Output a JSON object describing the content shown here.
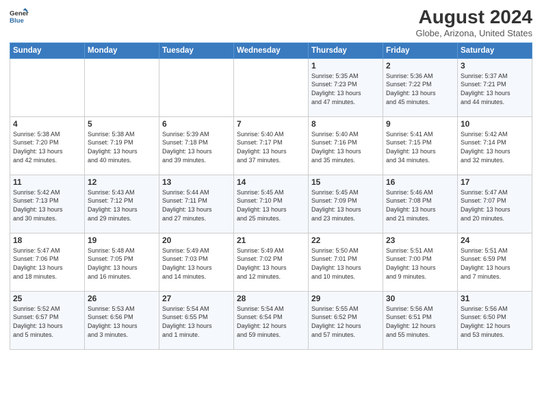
{
  "header": {
    "logo_line1": "General",
    "logo_line2": "Blue",
    "month_year": "August 2024",
    "location": "Globe, Arizona, United States"
  },
  "days_of_week": [
    "Sunday",
    "Monday",
    "Tuesday",
    "Wednesday",
    "Thursday",
    "Friday",
    "Saturday"
  ],
  "weeks": [
    [
      {
        "day": "",
        "content": ""
      },
      {
        "day": "",
        "content": ""
      },
      {
        "day": "",
        "content": ""
      },
      {
        "day": "",
        "content": ""
      },
      {
        "day": "1",
        "content": "Sunrise: 5:35 AM\nSunset: 7:23 PM\nDaylight: 13 hours\nand 47 minutes."
      },
      {
        "day": "2",
        "content": "Sunrise: 5:36 AM\nSunset: 7:22 PM\nDaylight: 13 hours\nand 45 minutes."
      },
      {
        "day": "3",
        "content": "Sunrise: 5:37 AM\nSunset: 7:21 PM\nDaylight: 13 hours\nand 44 minutes."
      }
    ],
    [
      {
        "day": "4",
        "content": "Sunrise: 5:38 AM\nSunset: 7:20 PM\nDaylight: 13 hours\nand 42 minutes."
      },
      {
        "day": "5",
        "content": "Sunrise: 5:38 AM\nSunset: 7:19 PM\nDaylight: 13 hours\nand 40 minutes."
      },
      {
        "day": "6",
        "content": "Sunrise: 5:39 AM\nSunset: 7:18 PM\nDaylight: 13 hours\nand 39 minutes."
      },
      {
        "day": "7",
        "content": "Sunrise: 5:40 AM\nSunset: 7:17 PM\nDaylight: 13 hours\nand 37 minutes."
      },
      {
        "day": "8",
        "content": "Sunrise: 5:40 AM\nSunset: 7:16 PM\nDaylight: 13 hours\nand 35 minutes."
      },
      {
        "day": "9",
        "content": "Sunrise: 5:41 AM\nSunset: 7:15 PM\nDaylight: 13 hours\nand 34 minutes."
      },
      {
        "day": "10",
        "content": "Sunrise: 5:42 AM\nSunset: 7:14 PM\nDaylight: 13 hours\nand 32 minutes."
      }
    ],
    [
      {
        "day": "11",
        "content": "Sunrise: 5:42 AM\nSunset: 7:13 PM\nDaylight: 13 hours\nand 30 minutes."
      },
      {
        "day": "12",
        "content": "Sunrise: 5:43 AM\nSunset: 7:12 PM\nDaylight: 13 hours\nand 29 minutes."
      },
      {
        "day": "13",
        "content": "Sunrise: 5:44 AM\nSunset: 7:11 PM\nDaylight: 13 hours\nand 27 minutes."
      },
      {
        "day": "14",
        "content": "Sunrise: 5:45 AM\nSunset: 7:10 PM\nDaylight: 13 hours\nand 25 minutes."
      },
      {
        "day": "15",
        "content": "Sunrise: 5:45 AM\nSunset: 7:09 PM\nDaylight: 13 hours\nand 23 minutes."
      },
      {
        "day": "16",
        "content": "Sunrise: 5:46 AM\nSunset: 7:08 PM\nDaylight: 13 hours\nand 21 minutes."
      },
      {
        "day": "17",
        "content": "Sunrise: 5:47 AM\nSunset: 7:07 PM\nDaylight: 13 hours\nand 20 minutes."
      }
    ],
    [
      {
        "day": "18",
        "content": "Sunrise: 5:47 AM\nSunset: 7:06 PM\nDaylight: 13 hours\nand 18 minutes."
      },
      {
        "day": "19",
        "content": "Sunrise: 5:48 AM\nSunset: 7:05 PM\nDaylight: 13 hours\nand 16 minutes."
      },
      {
        "day": "20",
        "content": "Sunrise: 5:49 AM\nSunset: 7:03 PM\nDaylight: 13 hours\nand 14 minutes."
      },
      {
        "day": "21",
        "content": "Sunrise: 5:49 AM\nSunset: 7:02 PM\nDaylight: 13 hours\nand 12 minutes."
      },
      {
        "day": "22",
        "content": "Sunrise: 5:50 AM\nSunset: 7:01 PM\nDaylight: 13 hours\nand 10 minutes."
      },
      {
        "day": "23",
        "content": "Sunrise: 5:51 AM\nSunset: 7:00 PM\nDaylight: 13 hours\nand 9 minutes."
      },
      {
        "day": "24",
        "content": "Sunrise: 5:51 AM\nSunset: 6:59 PM\nDaylight: 13 hours\nand 7 minutes."
      }
    ],
    [
      {
        "day": "25",
        "content": "Sunrise: 5:52 AM\nSunset: 6:57 PM\nDaylight: 13 hours\nand 5 minutes."
      },
      {
        "day": "26",
        "content": "Sunrise: 5:53 AM\nSunset: 6:56 PM\nDaylight: 13 hours\nand 3 minutes."
      },
      {
        "day": "27",
        "content": "Sunrise: 5:54 AM\nSunset: 6:55 PM\nDaylight: 13 hours\nand 1 minute."
      },
      {
        "day": "28",
        "content": "Sunrise: 5:54 AM\nSunset: 6:54 PM\nDaylight: 12 hours\nand 59 minutes."
      },
      {
        "day": "29",
        "content": "Sunrise: 5:55 AM\nSunset: 6:52 PM\nDaylight: 12 hours\nand 57 minutes."
      },
      {
        "day": "30",
        "content": "Sunrise: 5:56 AM\nSunset: 6:51 PM\nDaylight: 12 hours\nand 55 minutes."
      },
      {
        "day": "31",
        "content": "Sunrise: 5:56 AM\nSunset: 6:50 PM\nDaylight: 12 hours\nand 53 minutes."
      }
    ]
  ]
}
